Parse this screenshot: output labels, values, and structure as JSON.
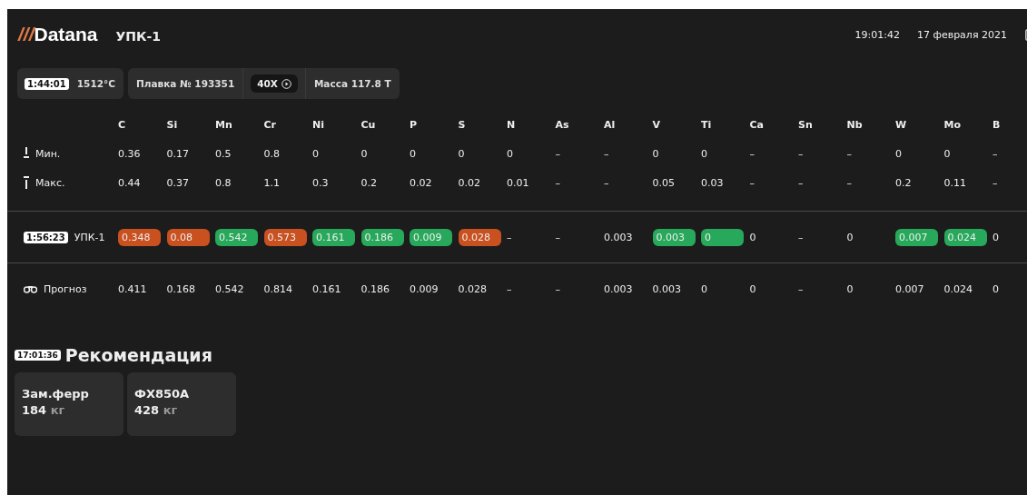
{
  "header": {
    "logo": {
      "mark": "///",
      "name": "Datana"
    },
    "unit": "УПК-1",
    "time": "19:01:42",
    "date": "17 февраля 2021"
  },
  "info_bar": {
    "timer": "1:44:01",
    "temperature": "1512°C",
    "heat": "Плавка № 193351",
    "grade": "40X",
    "mass": "Масса 117.8 Т"
  },
  "table": {
    "columns": [
      "C",
      "Si",
      "Mn",
      "Cr",
      "Ni",
      "Cu",
      "P",
      "S",
      "N",
      "As",
      "Al",
      "V",
      "Ti",
      "Ca",
      "Sn",
      "Nb",
      "W",
      "Mo",
      "B"
    ],
    "rows": [
      {
        "kind": "min",
        "label": "Мин.",
        "cells": [
          "0.36",
          "0.17",
          "0.5",
          "0.8",
          "0",
          "0",
          "0",
          "0",
          "0",
          "–",
          "–",
          "0",
          "0",
          "–",
          "–",
          "–",
          "0",
          "0",
          "–"
        ]
      },
      {
        "kind": "max",
        "label": "Макс.",
        "cells": [
          "0.44",
          "0.37",
          "0.8",
          "1.1",
          "0.3",
          "0.2",
          "0.02",
          "0.02",
          "0.01",
          "–",
          "–",
          "0.05",
          "0.03",
          "–",
          "–",
          "–",
          "0.2",
          "0.11",
          "–"
        ]
      },
      {
        "kind": "measure",
        "timer": "1:56:23",
        "label": "УПК-1",
        "cells": [
          {
            "value": "0.348",
            "color": "#c9501f"
          },
          {
            "value": "0.08",
            "color": "#c9501f"
          },
          {
            "value": "0.542",
            "color": "#27a85a"
          },
          {
            "value": "0.573",
            "color": "#c9501f"
          },
          {
            "value": "0.161",
            "color": "#27a85a"
          },
          {
            "value": "0.186",
            "color": "#27a85a"
          },
          {
            "value": "0.009",
            "color": "#27a85a"
          },
          {
            "value": "0.028",
            "color": "#c9501f"
          },
          {
            "value": "–"
          },
          {
            "value": "–"
          },
          {
            "value": "0.003"
          },
          {
            "value": "0.003",
            "color": "#27a85a"
          },
          {
            "value": "0",
            "color": "#27a85a"
          },
          {
            "value": "0"
          },
          {
            "value": "–"
          },
          {
            "value": "0"
          },
          {
            "value": "0.007",
            "color": "#27a85a"
          },
          {
            "value": "0.024",
            "color": "#27a85a"
          },
          {
            "value": "0"
          }
        ]
      },
      {
        "kind": "forecast",
        "label": "Прогноз",
        "cells": [
          "0.411",
          "0.168",
          "0.542",
          "0.814",
          "0.161",
          "0.186",
          "0.009",
          "0.028",
          "–",
          "–",
          "0.003",
          "0.003",
          "0",
          "0",
          "–",
          "0",
          "0.007",
          "0.024",
          "0"
        ]
      }
    ]
  },
  "recommendation": {
    "timer": "17:01:36",
    "title": "Рекомендация",
    "items": [
      {
        "name": "Зам.ферр",
        "amount": "184",
        "unit": "кг"
      },
      {
        "name": "ФХ850А",
        "amount": "428",
        "unit": "кг"
      }
    ]
  }
}
